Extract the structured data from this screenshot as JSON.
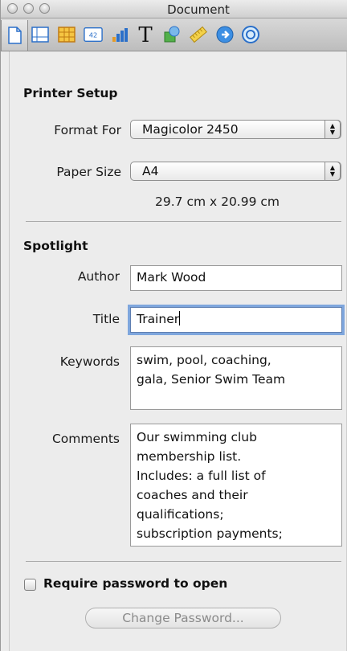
{
  "window": {
    "title": "Document"
  },
  "toolbar": {
    "tools": [
      {
        "name": "document-inspector-icon"
      },
      {
        "name": "layout-inspector-icon"
      },
      {
        "name": "table-inspector-icon"
      },
      {
        "name": "cell-format-icon",
        "text": "42"
      },
      {
        "name": "chart-inspector-icon"
      },
      {
        "name": "text-inspector-icon",
        "text": "T"
      },
      {
        "name": "graphic-inspector-icon"
      },
      {
        "name": "metrics-inspector-icon"
      },
      {
        "name": "hyperlink-inspector-icon"
      },
      {
        "name": "quicktime-inspector-icon"
      }
    ]
  },
  "printer_setup": {
    "title": "Printer Setup",
    "format_for_label": "Format For",
    "format_for_value": "Magicolor 2450",
    "paper_size_label": "Paper Size",
    "paper_size_value": "A4",
    "paper_dimensions": "29.7 cm x 20.99 cm"
  },
  "spotlight": {
    "title": "Spotlight",
    "author_label": "Author",
    "author_value": "Mark Wood",
    "title_label": "Title",
    "title_value": "Trainer",
    "keywords_label": "Keywords",
    "keywords_value": "swim, pool, coaching,\ngala, Senior Swim Team",
    "comments_label": "Comments",
    "comments_value": "Our swimming club\nmembership list.\nIncludes: a full list of\ncoaches and their\nqualifications;\nsubscription payments;"
  },
  "security": {
    "require_password_label": "Require password to open",
    "require_password_checked": false,
    "change_password_label": "Change Password..."
  }
}
